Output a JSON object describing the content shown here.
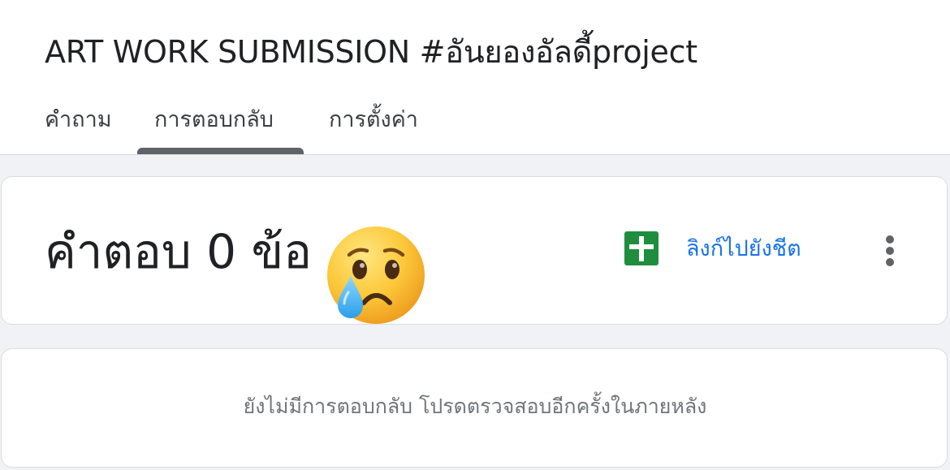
{
  "form": {
    "title": "ART WORK SUBMISSION #อันยองอัลดี้project"
  },
  "tabs": [
    {
      "label": "คำถาม",
      "selected": false
    },
    {
      "label": "การตอบกลับ",
      "selected": true
    },
    {
      "label": "การตั้งค่า",
      "selected": false
    }
  ],
  "summary": {
    "response_count_label": "คำตอบ 0 ข้อ",
    "emoji": "crying-face",
    "sheets_icon": "google-sheets-icon",
    "link_to_sheet_label": "ลิงก์ไปยังชีต",
    "more_icon": "more-vert-icon"
  },
  "empty_state": {
    "message": "ยังไม่มีการตอบกลับ โปรดตรวจสอบอีกครั้งในภายหลัง"
  },
  "colors": {
    "accent_link": "#1a73e8",
    "sheets_green": "#1e8e3e",
    "page_background": "#f0f2f6",
    "tab_indicator": "#5f6368"
  }
}
